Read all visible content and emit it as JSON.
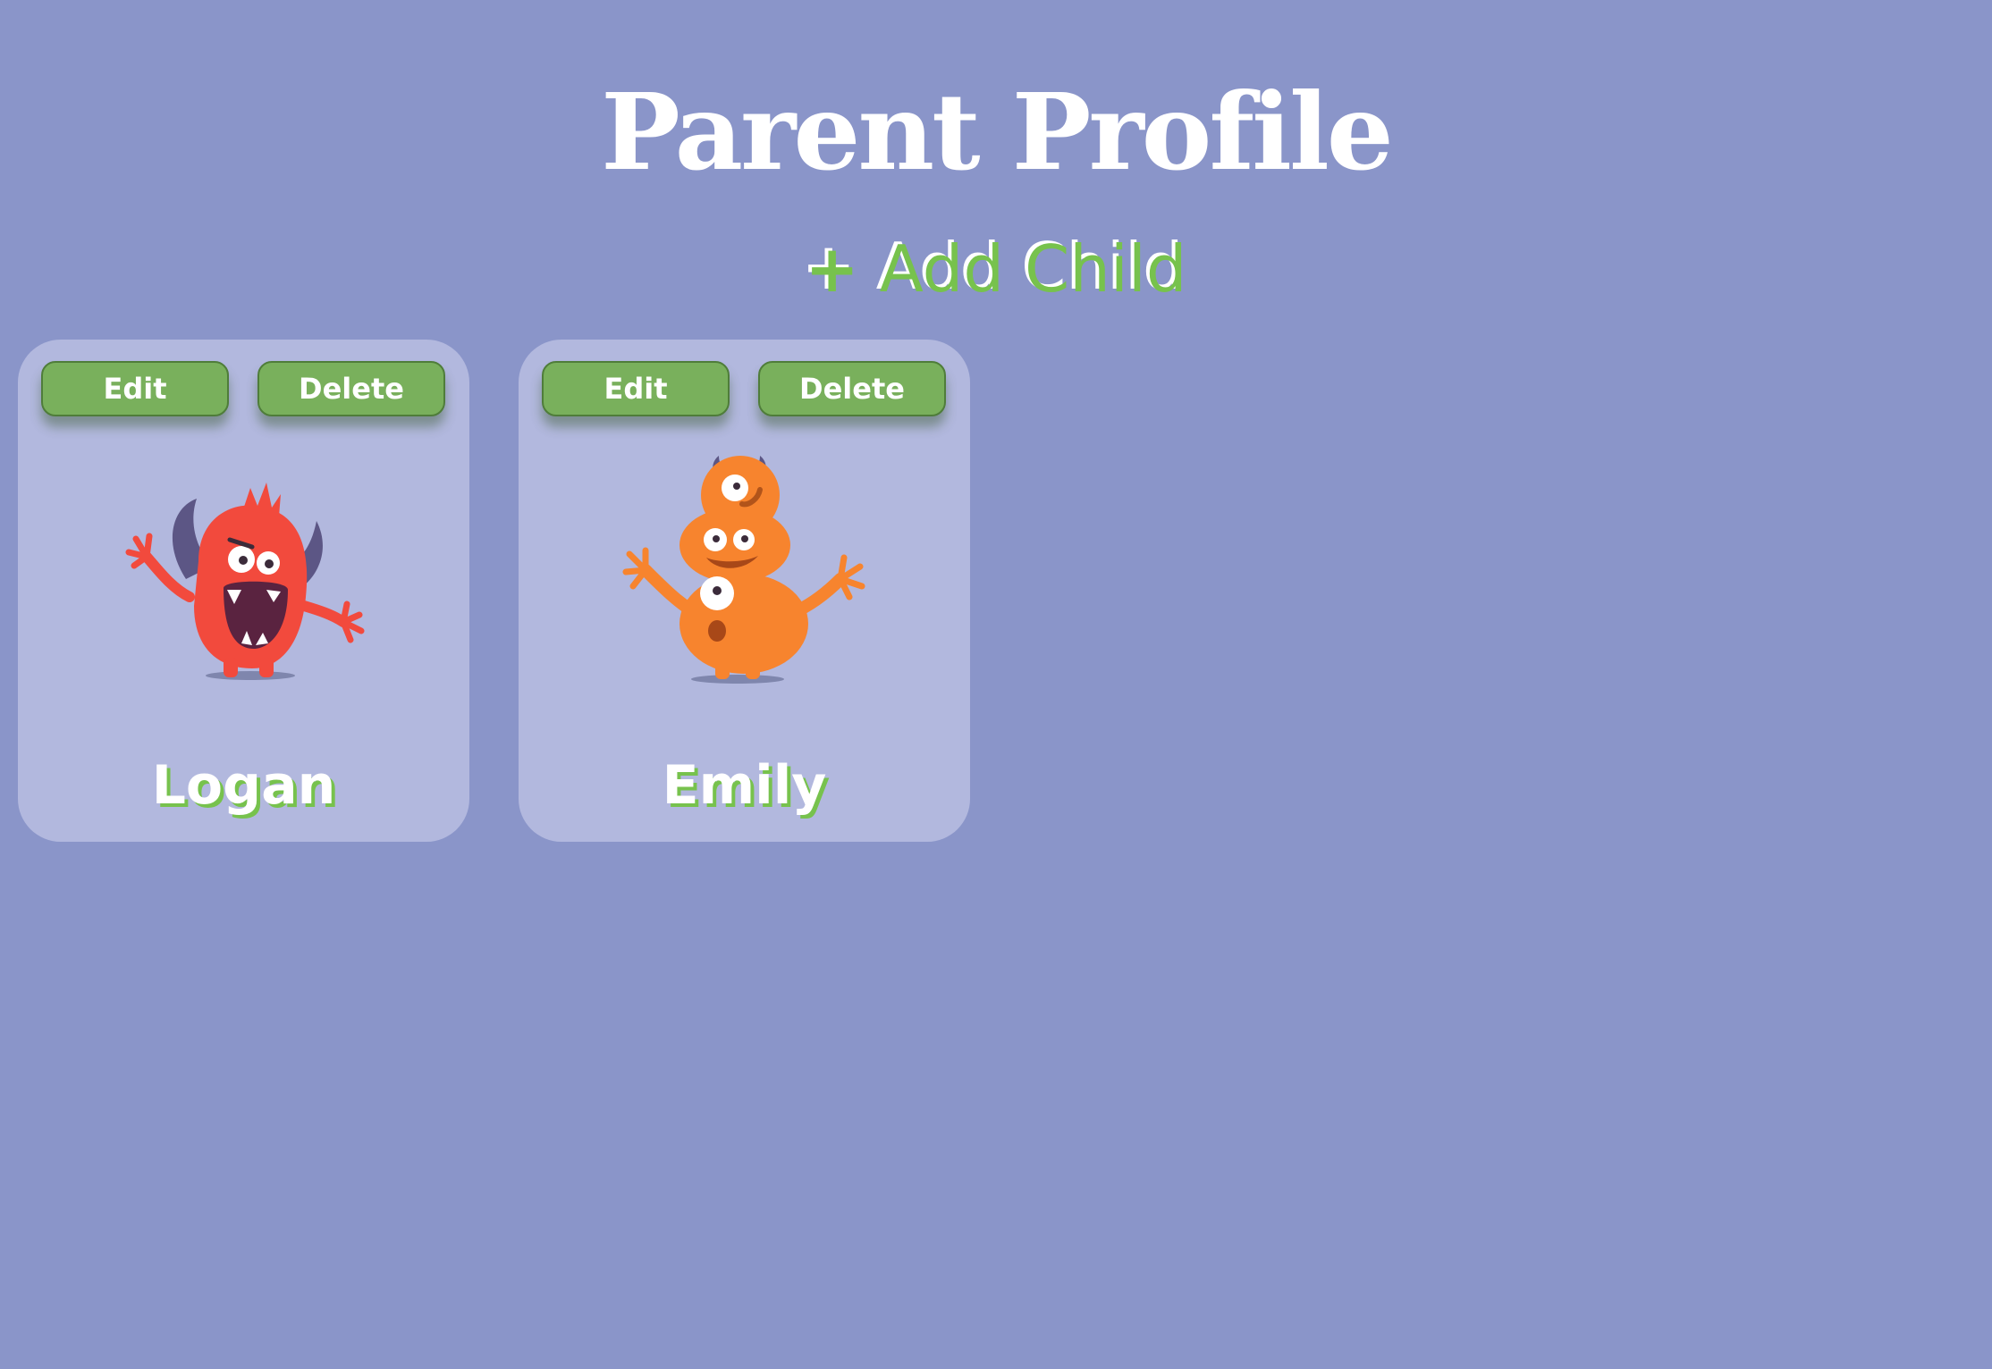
{
  "page": {
    "title": "Parent Profile"
  },
  "actions": {
    "add_child_plus": "+",
    "add_child_label": "Add Child"
  },
  "children": [
    {
      "name": "Logan",
      "avatar": "red-monster-icon",
      "edit_label": "Edit",
      "delete_label": "Delete"
    },
    {
      "name": "Emily",
      "avatar": "orange-monster-icon",
      "edit_label": "Edit",
      "delete_label": "Delete"
    }
  ],
  "colors": {
    "background": "#8a95c9",
    "card": "#b2b8de",
    "button": "#79b05c",
    "accent_green": "#77c24d",
    "red_monster": "#f24a3d",
    "orange_monster": "#f7842e",
    "horn": "#5c5685"
  }
}
